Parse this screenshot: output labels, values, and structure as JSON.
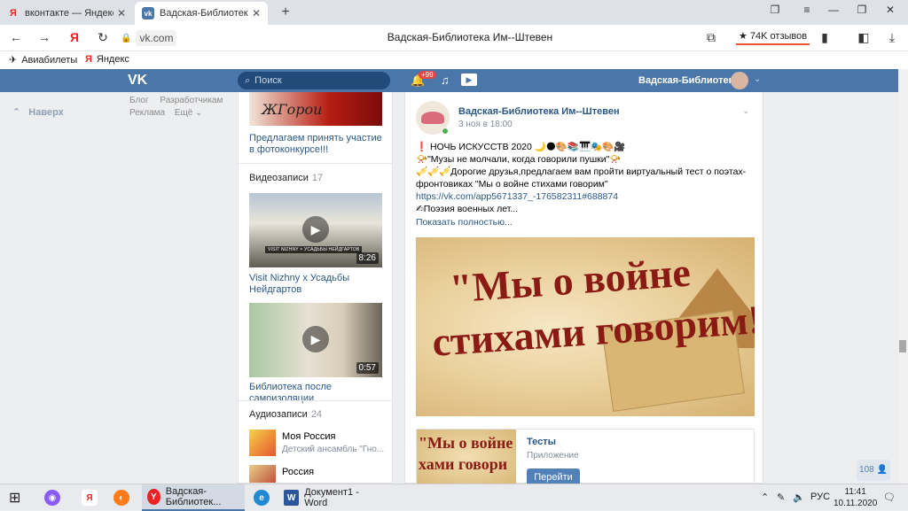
{
  "browser": {
    "tabs": [
      {
        "title": "вконтакте — Яндекс: наш",
        "favicon": "Я",
        "active": false
      },
      {
        "title": "Вадская-Библиотека И",
        "favicon": "vk",
        "active": true
      }
    ],
    "new_tab": "+",
    "address": "vk.com",
    "page_title": "Вадская-Библиотека Им--Штевен",
    "reviews": "★ 74K отзывов",
    "bookmarks": [
      {
        "label": "Авиабилеты",
        "icon": "plane-icon"
      },
      {
        "label": "Яндекс",
        "icon": "yandex-icon"
      }
    ]
  },
  "vk": {
    "search_placeholder": "Поиск",
    "notifications_badge": "+99",
    "user_name": "Вадская-Библиотека",
    "back_label": "Наверх",
    "footer_links": [
      [
        "Блог",
        "Разработчикам"
      ],
      [
        "Реклама",
        "Ещё ⌄"
      ]
    ]
  },
  "middle": {
    "photo_caption": "Предлагаем принять участие в фотоконкурсе!!!",
    "photo_script_text": "ЖГорои",
    "videos_header": "Видеозаписи",
    "videos_count": "17",
    "videos": [
      {
        "title": "Visit Nizhny x Усадьбы Нейдгартов",
        "duration": "8:26",
        "caption": "VISIT NIZHNY × УСАДЬБЫ НЕЙДГАРТОВ"
      },
      {
        "title": "Библиотека после самоизоляции",
        "duration": "0:57"
      }
    ],
    "audio_header": "Аудиозаписи",
    "audio_count": "24",
    "audios": [
      {
        "title": "Моя Россия",
        "artist": "Детский ансамбль \"Гно..."
      },
      {
        "title": "Россия",
        "artist": ""
      }
    ]
  },
  "post": {
    "author": "Вадская-Библиотека Им--Штевен",
    "date": "3 ноя в 18:00",
    "lines": [
      "❗ НОЧЬ ИСКУССТВ 2020 🌙🌑🎨📚🎹🎭🎨🎥",
      "📯\"Музы не молчали, когда говорили пушки\"📯",
      "🎺🎺🎺Дорогие друзья,предлагаем вам пройти виртуальный тест о поэтах-",
      "фронтовиках \"Мы о войне стихами говорим\"",
      "https://vk.com/app5671337_-176582311#688874",
      "✍Поэзия военных лет...",
      "Показать полностью..."
    ],
    "image_line1": "\"Мы о войне",
    "image_line2": "стихами говорим!\"",
    "app": {
      "thumb_line1": "\"Мы о войне",
      "thumb_line2": "хами говори",
      "title": "Тесты",
      "subtitle": "Приложение",
      "button": "Перейти"
    }
  },
  "viewers": "108 👤",
  "taskbar": {
    "items": [
      {
        "label": "Вадская-Библиотек...",
        "active": true
      },
      {
        "label": "Документ1 - Word",
        "active": false
      }
    ],
    "lang": "РУС",
    "time": "11:41",
    "date": "10.11.2020"
  },
  "colors": {
    "vk_blue": "#4a76a8",
    "link": "#2a5885",
    "background": "#edeef0"
  }
}
